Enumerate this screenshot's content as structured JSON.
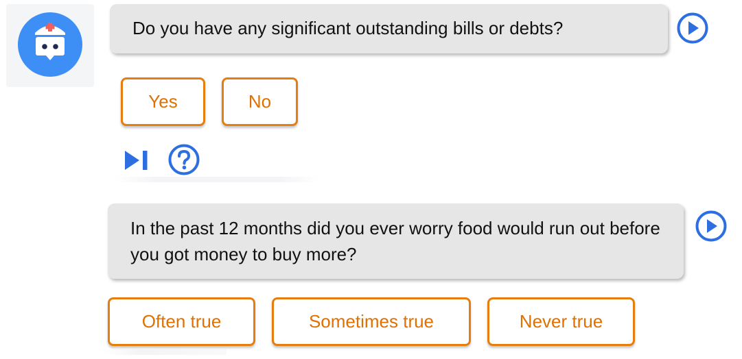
{
  "colors": {
    "accent_blue": "#2d6fe0",
    "button_orange": "#e07000",
    "bubble_gray": "#e6e6e6",
    "avatar_bg": "#3d8ef5"
  },
  "avatar": {
    "icon": "nurse-bot-icon"
  },
  "messages": [
    {
      "text": "Do you have any significant outstanding bills or debts?",
      "play_icon": "play-circle-icon",
      "answers": [
        {
          "label": "Yes"
        },
        {
          "label": "No"
        }
      ]
    },
    {
      "text": "In the past 12 months did you ever worry food would run out before you got money to buy more?",
      "play_icon": "play-circle-icon",
      "answers": [
        {
          "label": "Often true"
        },
        {
          "label": "Sometimes true"
        },
        {
          "label": "Never true"
        }
      ]
    }
  ],
  "controls": {
    "skip_icon": "skip-next-icon",
    "help_icon": "help-circle-icon"
  }
}
